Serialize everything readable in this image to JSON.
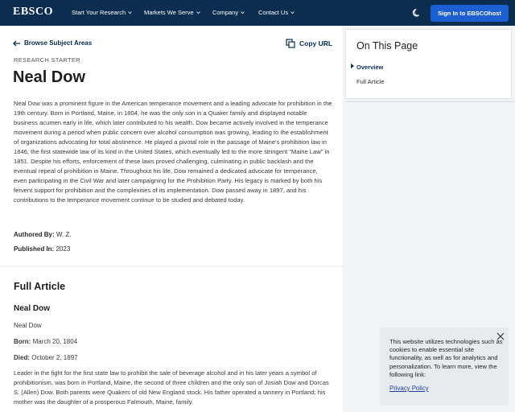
{
  "header": {
    "logo": "EBSCO",
    "nav": [
      {
        "label": "Start Your Research"
      },
      {
        "label": "Markets We Serve"
      },
      {
        "label": "Company"
      },
      {
        "label": "Contact Us"
      }
    ],
    "theme_icon": "moon-icon",
    "signin_label": "Sign In to EBSCOhost",
    "colors": {
      "bar": "#0a2d50",
      "signin": "#1c5fd2"
    }
  },
  "main": {
    "back_label": "Browse Subject Areas",
    "copy_label": "Copy URL",
    "eyebrow": "RESEARCH STARTER",
    "title": "Neal Dow",
    "summary": "Neal Dow was a prominent figure in the American temperance movement and a leading advocate for prohibition in the 19th century. Born in Portland, Maine, in 1804, he was the only son in a Quaker family and displayed notable business acumen early in life, which later contributed to his wealth. Dow became actively involved in the temperance movement during a period when public concern over alcohol consumption was growing, leading to the establishment of organizations advocating for total abstinence. He played a pivotal role in the passage of Maine's prohibition law in 1846, the first statewide law of its kind in the United States, which eventually led to the more stringent \"Maine Law\" in 1851. Despite his efforts, enforcement of these laws proved challenging, culminating in public backlash and the eventual repeal of prohibition in Maine. Throughout his life, Dow remained a dedicated advocate for temperance, even participating in the Civil War and later campaigning for the Prohibition Party. His legacy is marked by both his fervent support for prohibition and the complexities of its implementation. Dow passed away in 1897, and his contributions to the temperance movement continue to be studied and debated today.",
    "authored_label": "Authored By:",
    "authored_value": "W. Z.",
    "published_label": "Published In:",
    "published_value": "2023"
  },
  "article": {
    "heading": "Full Article",
    "subheading": "Neal Dow",
    "name": "Neal Dow",
    "born_label": "Born:",
    "born_value": "March 20, 1804",
    "died_label": "Died:",
    "died_value": "October 2, 1897",
    "body": "Leader in the fight for the first state law to prohibit the sale of beverage alcohol and in his later years a symbol of prohibitionism, was born in Portland, Maine, the second of three children and the only son of Josiah Dow and Dorcas S. (Allen) Dow. Both parents were Quakers of old New England stock. His father operated a tannery in Portland; his mother was the daughter of a prosperous Falmouth, Maine, family."
  },
  "sidebar": {
    "title": "On This Page",
    "items": [
      {
        "label": "Overview",
        "active": true
      },
      {
        "label": "Full Article",
        "active": false
      }
    ]
  },
  "cookie": {
    "text": "This website utilizes technologies such as cookies to enable essential site functionality, as well as for analytics and personalization. To learn more, view the following link:",
    "link": "Privacy Policy"
  }
}
